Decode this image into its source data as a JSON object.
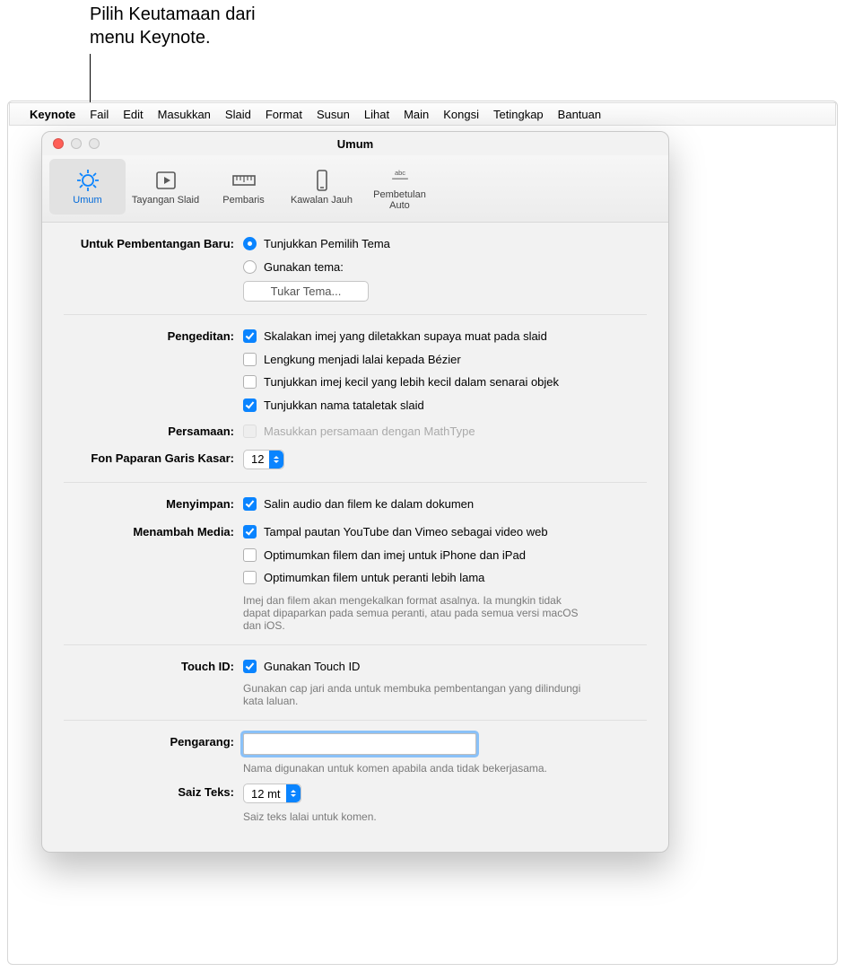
{
  "callout": {
    "text": "Pilih Keutamaan dari\nmenu Keynote."
  },
  "menubar": {
    "items": [
      "Keynote",
      "Fail",
      "Edit",
      "Masukkan",
      "Slaid",
      "Format",
      "Susun",
      "Lihat",
      "Main",
      "Kongsi",
      "Tetingkap",
      "Bantuan"
    ]
  },
  "window": {
    "title": "Umum"
  },
  "toolbar": {
    "tabs": [
      {
        "label": "Umum",
        "icon": "gear-icon",
        "selected": true
      },
      {
        "label": "Tayangan Slaid",
        "icon": "play-icon",
        "selected": false
      },
      {
        "label": "Pembaris",
        "icon": "ruler-icon",
        "selected": false
      },
      {
        "label": "Kawalan Jauh",
        "icon": "phone-icon",
        "selected": false
      },
      {
        "label": "Pembetulan Auto",
        "icon": "abc-icon",
        "selected": false
      }
    ]
  },
  "prefs": {
    "new_presentation": {
      "label": "Untuk Pembentangan Baru:",
      "show_chooser": "Tunjukkan Pemilih Tema",
      "use_theme": "Gunakan tema:",
      "change_theme_btn": "Tukar Tema...",
      "selected": "show_chooser"
    },
    "editing": {
      "label": "Pengeditan:",
      "scale_images": {
        "text": "Skalakan imej yang diletakkan supaya muat pada slaid",
        "checked": true
      },
      "curves_bezier": {
        "text": "Lengkung menjadi lalai kepada Bézier",
        "checked": false
      },
      "small_thumbs": {
        "text": "Tunjukkan imej kecil yang lebih kecil dalam senarai objek",
        "checked": false
      },
      "show_layout_names": {
        "text": "Tunjukkan nama tataletak slaid",
        "checked": true
      }
    },
    "equations": {
      "label": "Persamaan:",
      "mathtype": {
        "text": "Masukkan persamaan dengan MathType",
        "checked": false,
        "disabled": true
      }
    },
    "outline_font": {
      "label": "Fon Paparan Garis Kasar:",
      "value": "12"
    },
    "saving": {
      "label": "Menyimpan:",
      "copy_media": {
        "text": "Salin audio dan filem ke dalam dokumen",
        "checked": true
      }
    },
    "adding_media": {
      "label": "Menambah Media:",
      "paste_web": {
        "text": "Tampal pautan YouTube dan Vimeo sebagai video web",
        "checked": true
      },
      "optimize_ios": {
        "text": "Optimumkan filem dan imej untuk iPhone dan iPad",
        "checked": false
      },
      "optimize_old": {
        "text": "Optimumkan filem untuk peranti lebih lama",
        "checked": false
      },
      "note": "Imej dan filem akan mengekalkan format asalnya. Ia mungkin tidak dapat dipaparkan pada semua peranti, atau pada semua versi macOS dan iOS."
    },
    "touchid": {
      "label": "Touch ID:",
      "use": {
        "text": "Gunakan Touch ID",
        "checked": true
      },
      "note": "Gunakan cap jari anda untuk membuka pembentangan yang dilindungi kata laluan."
    },
    "author": {
      "label": "Pengarang:",
      "value": "",
      "note": "Nama digunakan untuk komen apabila anda tidak bekerjasama."
    },
    "text_size": {
      "label": "Saiz Teks:",
      "value": "12 mt",
      "note": "Saiz teks lalai untuk komen."
    }
  }
}
